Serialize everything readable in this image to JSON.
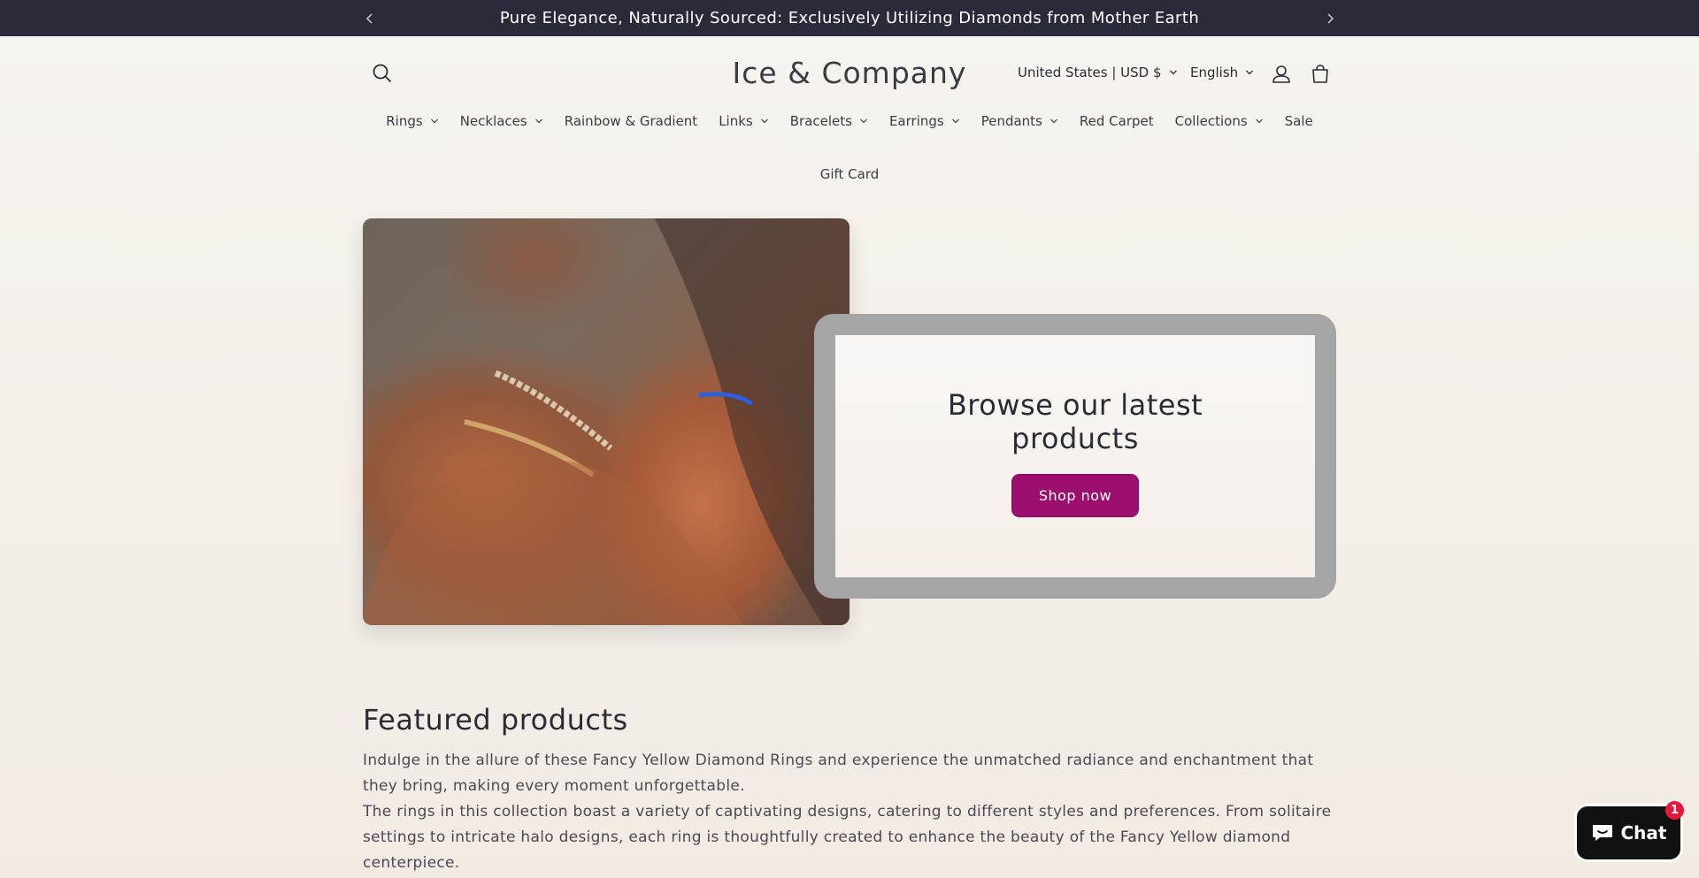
{
  "announcement": {
    "text": "Pure Elegance, Naturally Sourced: Exclusively Utilizing Diamonds from Mother Earth",
    "prev_icon": "chevron-left-icon",
    "next_icon": "chevron-right-icon"
  },
  "header": {
    "logo": "Ice & Company",
    "country_selector": "United States | USD $",
    "language_selector": "English",
    "icons": [
      "search-icon",
      "account-icon",
      "cart-icon"
    ]
  },
  "nav": {
    "items": [
      {
        "label": "Rings",
        "dropdown": true
      },
      {
        "label": "Necklaces",
        "dropdown": true
      },
      {
        "label": "Rainbow & Gradient",
        "dropdown": false
      },
      {
        "label": "Links",
        "dropdown": true
      },
      {
        "label": "Bracelets",
        "dropdown": true
      },
      {
        "label": "Earrings",
        "dropdown": true
      },
      {
        "label": "Pendants",
        "dropdown": true
      },
      {
        "label": "Red Carpet",
        "dropdown": false
      },
      {
        "label": "Collections",
        "dropdown": true
      },
      {
        "label": "Sale",
        "dropdown": false
      },
      {
        "label": "Gift Card",
        "dropdown": false
      }
    ]
  },
  "hero": {
    "title": "Browse our latest products",
    "button": "Shop now",
    "button_color": "#9b0f6e"
  },
  "featured": {
    "title": "Featured products",
    "paragraph1": "Indulge in the allure of these Fancy Yellow Diamond Rings and experience the unmatched radiance and enchantment that they bring, making every moment unforgettable.",
    "paragraph2": "The rings in this collection boast a variety of captivating designs, catering to different styles and preferences. From solitaire settings to intricate halo designs, each ring is thoughtfully created to enhance the beauty of the Fancy Yellow diamond centerpiece."
  },
  "chat": {
    "label": "Chat",
    "badge_count": "1",
    "icon": "chat-bubble-icon"
  }
}
